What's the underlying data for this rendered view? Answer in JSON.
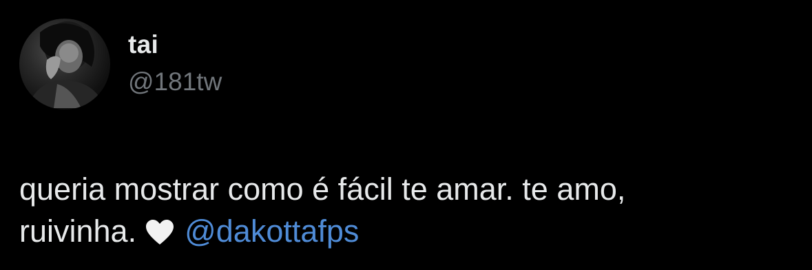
{
  "author": {
    "display_name": "tai",
    "handle": "@181tw",
    "avatar_icon": "profile-photo"
  },
  "tweet": {
    "line1": "queria mostrar como é fácil te amar. te amo,",
    "line2_text": "ruivinha.",
    "emoji_icon": "white-heart",
    "mention": "@dakottafps"
  },
  "colors": {
    "background": "#000000",
    "text": "#e7e9ea",
    "secondary_text": "#71767b",
    "mention": "#4f8bd6"
  }
}
